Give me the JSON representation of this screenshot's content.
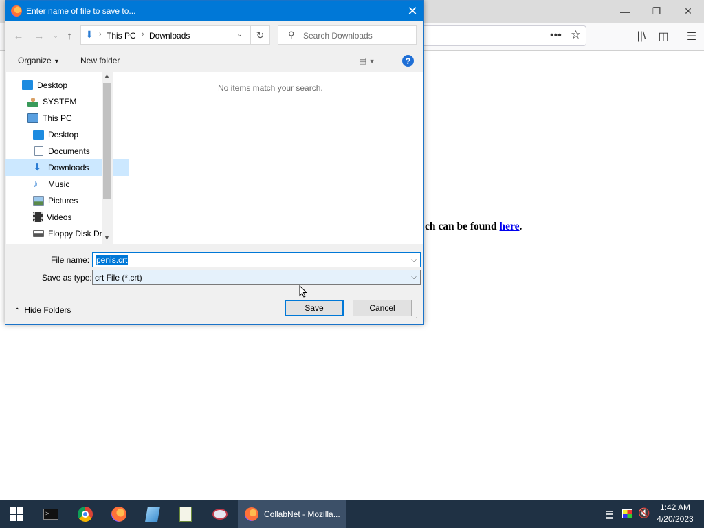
{
  "browser": {
    "page_text_prefix": "ch can be found ",
    "page_link": "here",
    "page_text_suffix": "."
  },
  "dialog": {
    "title": "Enter name of file to save to...",
    "breadcrumb": [
      "This PC",
      "Downloads"
    ],
    "search_placeholder": "Search Downloads",
    "organize_label": "Organize",
    "new_folder_label": "New folder",
    "empty_message": "No items match your search.",
    "nav_items": [
      {
        "label": "Desktop",
        "icon": "desktop-icon"
      },
      {
        "label": "SYSTEM",
        "icon": "user-icon"
      },
      {
        "label": "This PC",
        "icon": "computer-icon"
      },
      {
        "label": "Desktop",
        "icon": "desktop-icon"
      },
      {
        "label": "Documents",
        "icon": "documents-icon"
      },
      {
        "label": "Downloads",
        "icon": "download-arrow-icon"
      },
      {
        "label": "Music",
        "icon": "music-note-icon"
      },
      {
        "label": "Pictures",
        "icon": "pictures-icon"
      },
      {
        "label": "Videos",
        "icon": "film-icon"
      },
      {
        "label": "Floppy Disk Dri",
        "icon": "floppy-drive-icon"
      }
    ],
    "file_name_label": "File name:",
    "file_name_value": "penis.crt",
    "save_type_label": "Save as type:",
    "save_type_value": "crt File (*.crt)",
    "hide_folders_label": "Hide Folders",
    "save_label": "Save",
    "cancel_label": "Cancel"
  },
  "taskbar": {
    "active_app_label": "CollabNet - Mozilla...",
    "time": "1:42 AM",
    "date": "4/20/2023"
  },
  "colors": {
    "accent": "#0078d7",
    "taskbar": "#1f3144",
    "selection": "#cce8ff"
  }
}
